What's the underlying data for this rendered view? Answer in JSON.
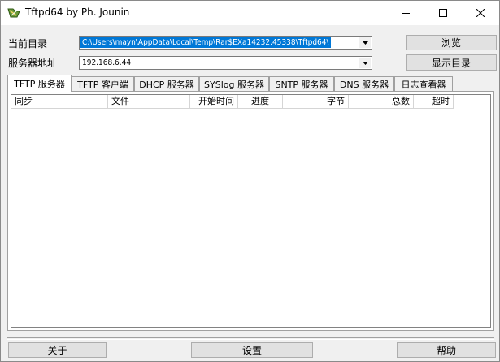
{
  "window": {
    "title": "Tftpd64 by Ph. Jounin"
  },
  "form": {
    "current_dir_label": "当前目录",
    "current_dir_value": "C:\\Users\\mayn\\AppData\\Local\\Temp\\Rar$EXa14232.45338\\Tftpd64\\",
    "server_addr_label": "服务器地址",
    "server_addr_value": "192.168.6.44",
    "browse_label": "浏览",
    "show_dir_label": "显示目录"
  },
  "tabs": [
    {
      "label": "TFTP 服务器",
      "active": true
    },
    {
      "label": "TFTP 客户端"
    },
    {
      "label": "DHCP 服务器"
    },
    {
      "label": "SYSlog 服务器"
    },
    {
      "label": "SNTP 服务器"
    },
    {
      "label": "DNS 服务器"
    },
    {
      "label": "日志查看器"
    }
  ],
  "table": {
    "columns": [
      "同步",
      "文件",
      "开始时间",
      "进度",
      "字节",
      "总数",
      "超时"
    ]
  },
  "footer": {
    "about_label": "关于",
    "settings_label": "设置",
    "help_label": "帮助"
  }
}
